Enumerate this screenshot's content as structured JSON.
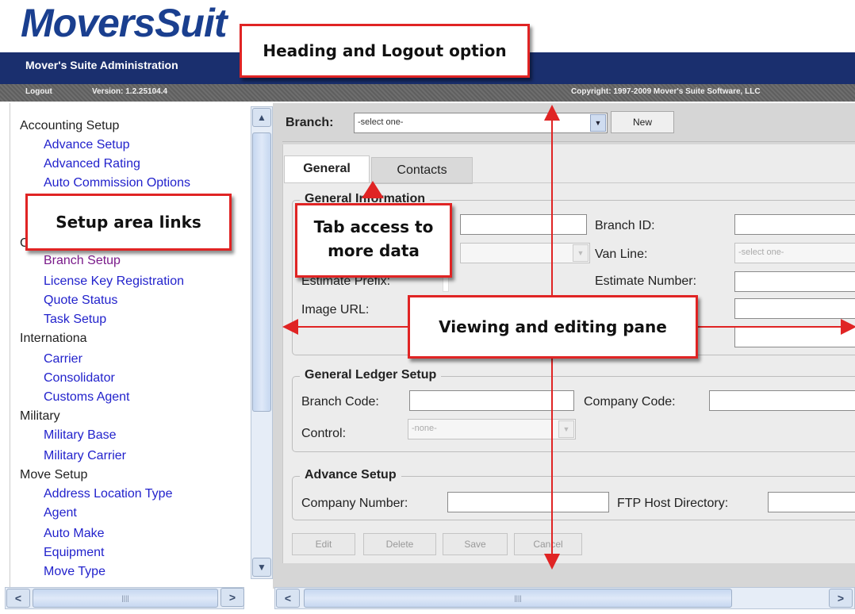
{
  "header": {
    "logo_text": "MoversSuit",
    "admin_title": "Mover's Suite Administration",
    "logout": "Logout",
    "version": "Version: 1.2.25104.4",
    "copyright": "Copyright: 1997-2009 Mover's Suite Software, LLC"
  },
  "sidebar": {
    "groups": [
      {
        "label": "Accounting Setup",
        "items": [
          "Advance Setup",
          "Advanced Rating",
          "Auto Commission Options"
        ]
      },
      {
        "label": "C",
        "items": [
          "Branch Setup",
          "License Key Registration",
          "Quote Status",
          "Task Setup"
        ]
      },
      {
        "label": "Internationa",
        "items": [
          "Carrier",
          "Consolidator",
          "Customs Agent"
        ]
      },
      {
        "label": "Military",
        "items": [
          "Military Base",
          "Military Carrier"
        ]
      },
      {
        "label": "Move Setup",
        "items": [
          "Address Location Type",
          "Agent",
          "Auto Make",
          "Equipment",
          "Move Type"
        ]
      }
    ]
  },
  "branch_bar": {
    "label": "Branch:",
    "select_value": "-select one-",
    "new_button": "New"
  },
  "tabs": [
    "General",
    "Contacts"
  ],
  "general_info": {
    "legend": "General Information",
    "branch_id_label": "Branch ID:",
    "van_line_label": "Van Line:",
    "van_line_value": "-select one-",
    "estimate_prefix_label": "Estimate Prefix:",
    "estimate_number_label": "Estimate Number:",
    "image_url_label": "Image URL:"
  },
  "gl_setup": {
    "legend": "General Ledger Setup",
    "branch_code_label": "Branch Code:",
    "company_code_label": "Company Code:",
    "control_label": "Control:",
    "control_value": "-none-"
  },
  "advance_setup": {
    "legend": "Advance Setup",
    "company_number_label": "Company Number:",
    "ftp_label": "FTP Host Directory:"
  },
  "actions": [
    "Edit",
    "Delete",
    "Save",
    "Cancel"
  ],
  "callouts": {
    "heading": "Heading and Logout option",
    "setup_links": "Setup area links",
    "tab_access_1": "Tab access to",
    "tab_access_2": "more data",
    "viewing_pane": "Viewing and editing pane"
  },
  "colors": {
    "callout_border": "#e02424",
    "nav_bar": "#1a2f6e",
    "link": "#2222cc",
    "visited_link": "#7a1b8a"
  }
}
